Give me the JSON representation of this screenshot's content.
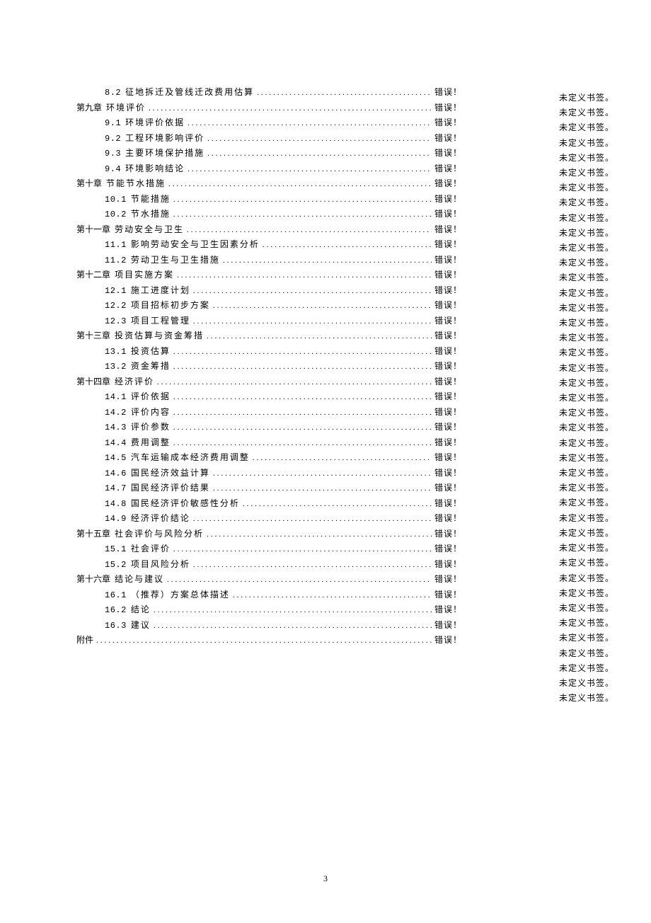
{
  "toc_entries": [
    {
      "level": 2,
      "num": "8.2",
      "title": "征地拆迁及管线迁改费用估算",
      "suffix": "错误！"
    },
    {
      "level": 1,
      "num": "第九章",
      "title": "环境评价",
      "suffix": "错误！"
    },
    {
      "level": 2,
      "num": "9.1",
      "title": "环境评价依据",
      "suffix": "错误！"
    },
    {
      "level": 2,
      "num": "9.2",
      "title": "工程环境影响评价",
      "suffix": "错误！"
    },
    {
      "level": 2,
      "num": "9.3",
      "title": "主要环境保护措施",
      "suffix": "错误！"
    },
    {
      "level": 2,
      "num": "9.4",
      "title": "环境影响结论",
      "suffix": "错误！"
    },
    {
      "level": 1,
      "num": "第十章",
      "title": "节能节水措施",
      "suffix": "错误！"
    },
    {
      "level": 2,
      "num": "10.1",
      "title": "节能措施",
      "suffix": "错误！"
    },
    {
      "level": 2,
      "num": "10.2",
      "title": "节水措施",
      "suffix": "错误！"
    },
    {
      "level": 1,
      "num": "第十一章",
      "title": "劳动安全与卫生",
      "suffix": "错误！"
    },
    {
      "level": 2,
      "num": "11.1",
      "title": "影响劳动安全与卫生因素分析",
      "suffix": "错误！"
    },
    {
      "level": 2,
      "num": "11.2",
      "title": "劳动卫生与卫生措施",
      "suffix": "错误！"
    },
    {
      "level": 1,
      "num": "第十二章",
      "title": "项目实施方案",
      "suffix": "错误！"
    },
    {
      "level": 2,
      "num": "12.1",
      "title": "施工进度计划",
      "suffix": "错误！"
    },
    {
      "level": 2,
      "num": "12.2",
      "title": "项目招标初步方案",
      "suffix": "错误！"
    },
    {
      "level": 2,
      "num": "12.3",
      "title": "项目工程管理",
      "suffix": "错误！"
    },
    {
      "level": 1,
      "num": "第十三章",
      "title": "投资估算与资金筹措",
      "suffix": "错误！"
    },
    {
      "level": 2,
      "num": "13.1",
      "title": "投资估算",
      "suffix": "错误！"
    },
    {
      "level": 2,
      "num": "13.2",
      "title": "资金筹措",
      "suffix": "错误！"
    },
    {
      "level": 1,
      "num": "第十四章",
      "title": "经济评价",
      "suffix": "错误！"
    },
    {
      "level": 2,
      "num": "14.1",
      "title": "评价依据",
      "suffix": "错误！"
    },
    {
      "level": 2,
      "num": "14.2",
      "title": "评价内容",
      "suffix": "错误！"
    },
    {
      "level": 2,
      "num": "14.3",
      "title": "评价参数",
      "suffix": "错误！"
    },
    {
      "level": 2,
      "num": "14.4",
      "title": "费用调整",
      "suffix": "错误！"
    },
    {
      "level": 2,
      "num": "14.5",
      "title": "汽车运输成本经济费用调整",
      "suffix": "错误！"
    },
    {
      "level": 2,
      "num": "14.6",
      "title": "国民经济效益计算",
      "suffix": "错误！"
    },
    {
      "level": 2,
      "num": "14.7",
      "title": "国民经济评价结果",
      "suffix": "错误！"
    },
    {
      "level": 2,
      "num": "14.8",
      "title": "国民经济评价敏感性分析",
      "suffix": "错误！"
    },
    {
      "level": 2,
      "num": "14.9",
      "title": "经济评价结论",
      "suffix": "错误！"
    },
    {
      "level": 1,
      "num": "第十五章",
      "title": "社会评价与风险分析",
      "suffix": "错误！"
    },
    {
      "level": 2,
      "num": "15.1",
      "title": "社会评价",
      "suffix": "错误！"
    },
    {
      "level": 2,
      "num": "15.2",
      "title": "项目风险分析",
      "suffix": "错误！"
    },
    {
      "level": 1,
      "num": "第十六章",
      "title": "结论与建议",
      "suffix": "错误！"
    },
    {
      "level": 2,
      "num": "16.1",
      "title": "（推荐）方案总体描述",
      "suffix": "错误！"
    },
    {
      "level": 2,
      "num": "16.2",
      "title": "结论",
      "suffix": "错误！"
    },
    {
      "level": 2,
      "num": "16.3",
      "title": "建议",
      "suffix": "错误！"
    },
    {
      "level": 1,
      "num": "附件",
      "title": "",
      "suffix": "错误！"
    }
  ],
  "bookmark_text": "未定义书签。",
  "bookmark_count": 41,
  "page_number": "3"
}
